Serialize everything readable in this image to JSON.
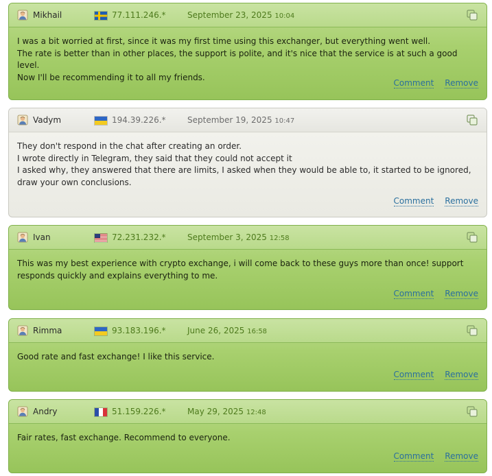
{
  "colors": {
    "positive_bg": "#a8d06e",
    "neutral_bg": "#eaeae3",
    "link": "#2a6f9e",
    "meta_green": "#4d7a1c",
    "meta_grey": "#6c6c6c"
  },
  "actions": {
    "comment": "Comment",
    "remove": "Remove"
  },
  "reviews": [
    {
      "name": "Mikhail",
      "flag": "flag-sweden-icon",
      "ip": "77.111.246.*",
      "date": "September 23, 2025",
      "time": "10:04",
      "text": "I was a bit worried at first, since it was my first time using this exchanger, but everything went well.\nThe rate is better than in other places, the support is polite, and it's nice that the service is at such a good level.\nNow I'll be recommending it to all my friends."
    },
    {
      "name": "Vadym",
      "flag": "flag-ukraine-icon",
      "ip": "194.39.226.*",
      "date": "September 19, 2025",
      "time": "10:47",
      "text": "They don't respond in the chat after creating an order.\nI wrote directly in Telegram, they said that they could not accept it\nI asked why, they answered that there are limits, I asked when they would be able to, it started to be ignored,\ndraw your own conclusions."
    },
    {
      "name": "Ivan",
      "flag": "flag-usa-icon",
      "ip": "72.231.232.*",
      "date": "September 3, 2025",
      "time": "12:58",
      "text": "This was my best experience with crypto exchange, i will come back to these guys more than once! support\nresponds quickly and explains everything to me."
    },
    {
      "name": "Rimma",
      "flag": "flag-ukraine-icon",
      "ip": "93.183.196.*",
      "date": "June 26, 2025",
      "time": "16:58",
      "text": "Good rate and fast exchange! I like this service."
    },
    {
      "name": "Andry",
      "flag": "flag-france-icon",
      "ip": "51.159.226.*",
      "date": "May 29, 2025",
      "time": "12:48",
      "text": "Fair rates, fast exchange. Recommend to everyone."
    }
  ]
}
